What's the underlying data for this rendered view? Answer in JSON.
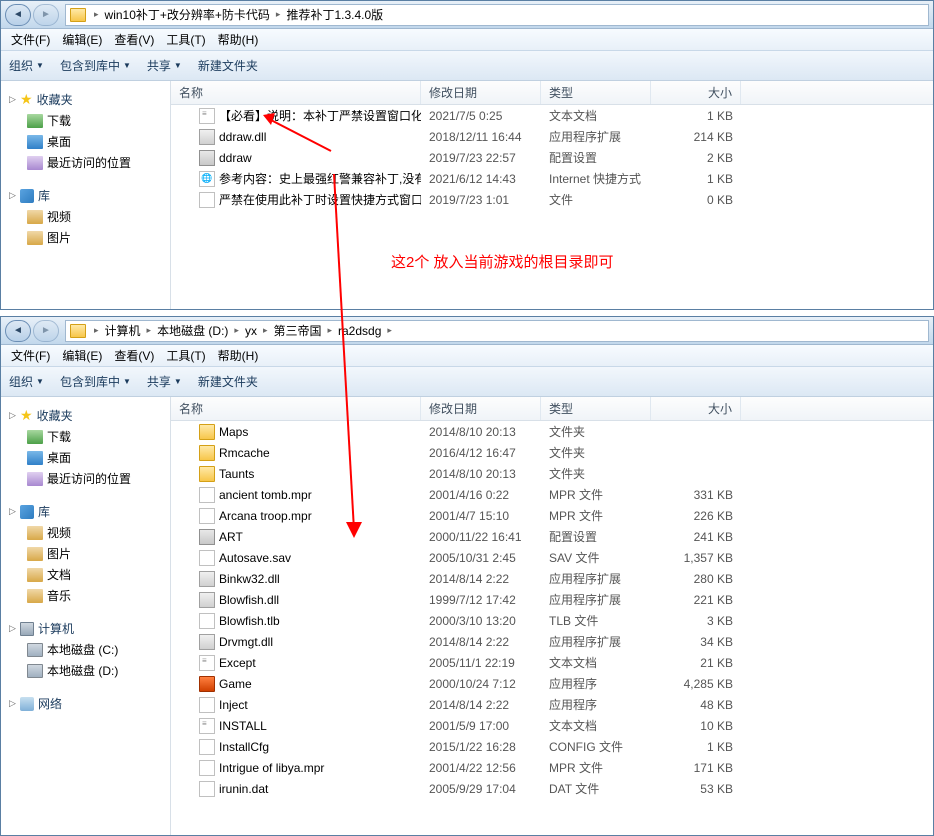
{
  "win1": {
    "breadcrumb": [
      "win10补丁+改分辨率+防卡代码",
      "推荐补丁1.3.4.0版"
    ],
    "menubar": [
      "文件(F)",
      "编辑(E)",
      "查看(V)",
      "工具(T)",
      "帮助(H)"
    ],
    "toolbar": {
      "organize": "组织",
      "include": "包含到库中",
      "share": "共享",
      "newfolder": "新建文件夹"
    },
    "columns": {
      "name": "名称",
      "date": "修改日期",
      "type": "类型",
      "size": "大小"
    },
    "sidebar": {
      "favorites": "收藏夹",
      "fav_items": [
        {
          "label": "下载",
          "icon": "ico-dl"
        },
        {
          "label": "桌面",
          "icon": "ico-desk"
        },
        {
          "label": "最近访问的位置",
          "icon": "ico-recent"
        }
      ],
      "libraries": "库",
      "lib_items": [
        {
          "label": "视频",
          "icon": "ico-lib"
        },
        {
          "label": "图片",
          "icon": "ico-lib"
        }
      ]
    },
    "files": [
      {
        "name": "【必看】说明：本补丁严禁设置窗口化",
        "date": "2021/7/5 0:25",
        "type": "文本文档",
        "size": "1 KB",
        "icon": "fico-txt"
      },
      {
        "name": "ddraw.dll",
        "date": "2018/12/11 16:44",
        "type": "应用程序扩展",
        "size": "214 KB",
        "icon": "fico-dll"
      },
      {
        "name": "ddraw",
        "date": "2019/7/23 22:57",
        "type": "配置设置",
        "size": "2 KB",
        "icon": "fico-cfg"
      },
      {
        "name": "参考内容：史上最强红警兼容补丁,没有...",
        "date": "2021/6/12 14:43",
        "type": "Internet 快捷方式",
        "size": "1 KB",
        "icon": "fico-url"
      },
      {
        "name": "严禁在使用此补丁时设置快捷方式窗口化...",
        "date": "2019/7/23 1:01",
        "type": "文件",
        "size": "0 KB",
        "icon": "fico-generic"
      }
    ]
  },
  "annotation_text": "这2个  放入当前游戏的根目录即可",
  "win2": {
    "breadcrumb": [
      "计算机",
      "本地磁盘 (D:)",
      "yx",
      "第三帝国",
      "ra2dsdg"
    ],
    "menubar": [
      "文件(F)",
      "编辑(E)",
      "查看(V)",
      "工具(T)",
      "帮助(H)"
    ],
    "toolbar": {
      "organize": "组织",
      "include": "包含到库中",
      "share": "共享",
      "newfolder": "新建文件夹"
    },
    "columns": {
      "name": "名称",
      "date": "修改日期",
      "type": "类型",
      "size": "大小"
    },
    "sidebar": {
      "favorites": "收藏夹",
      "fav_items": [
        {
          "label": "下载",
          "icon": "ico-dl"
        },
        {
          "label": "桌面",
          "icon": "ico-desk"
        },
        {
          "label": "最近访问的位置",
          "icon": "ico-recent"
        }
      ],
      "libraries": "库",
      "lib_items": [
        {
          "label": "视频",
          "icon": "ico-lib"
        },
        {
          "label": "图片",
          "icon": "ico-lib"
        },
        {
          "label": "文档",
          "icon": "ico-lib"
        },
        {
          "label": "音乐",
          "icon": "ico-lib"
        }
      ],
      "computer": "计算机",
      "comp_items": [
        {
          "label": "本地磁盘 (C:)",
          "icon": "ico-drive"
        },
        {
          "label": "本地磁盘 (D:)",
          "icon": "ico-drive"
        }
      ],
      "network": "网络"
    },
    "files": [
      {
        "name": "Maps",
        "date": "2014/8/10 20:13",
        "type": "文件夹",
        "size": "",
        "icon": "fico-folder"
      },
      {
        "name": "Rmcache",
        "date": "2016/4/12 16:47",
        "type": "文件夹",
        "size": "",
        "icon": "fico-folder"
      },
      {
        "name": "Taunts",
        "date": "2014/8/10 20:13",
        "type": "文件夹",
        "size": "",
        "icon": "fico-folder"
      },
      {
        "name": "ancient tomb.mpr",
        "date": "2001/4/16 0:22",
        "type": "MPR 文件",
        "size": "331 KB",
        "icon": "fico-generic"
      },
      {
        "name": "Arcana troop.mpr",
        "date": "2001/4/7 15:10",
        "type": "MPR 文件",
        "size": "226 KB",
        "icon": "fico-generic"
      },
      {
        "name": "ART",
        "date": "2000/11/22 16:41",
        "type": "配置设置",
        "size": "241 KB",
        "icon": "fico-cfg"
      },
      {
        "name": "Autosave.sav",
        "date": "2005/10/31 2:45",
        "type": "SAV 文件",
        "size": "1,357 KB",
        "icon": "fico-generic"
      },
      {
        "name": "Binkw32.dll",
        "date": "2014/8/14 2:22",
        "type": "应用程序扩展",
        "size": "280 KB",
        "icon": "fico-dll"
      },
      {
        "name": "Blowfish.dll",
        "date": "1999/7/12 17:42",
        "type": "应用程序扩展",
        "size": "221 KB",
        "icon": "fico-dll"
      },
      {
        "name": "Blowfish.tlb",
        "date": "2000/3/10 13:20",
        "type": "TLB 文件",
        "size": "3 KB",
        "icon": "fico-generic"
      },
      {
        "name": "Drvmgt.dll",
        "date": "2014/8/14 2:22",
        "type": "应用程序扩展",
        "size": "34 KB",
        "icon": "fico-dll"
      },
      {
        "name": "Except",
        "date": "2005/11/1 22:19",
        "type": "文本文档",
        "size": "21 KB",
        "icon": "fico-txt"
      },
      {
        "name": "Game",
        "date": "2000/10/24 7:12",
        "type": "应用程序",
        "size": "4,285 KB",
        "icon": "fico-exe"
      },
      {
        "name": "Inject",
        "date": "2014/8/14 2:22",
        "type": "应用程序",
        "size": "48 KB",
        "icon": "fico-generic"
      },
      {
        "name": "INSTALL",
        "date": "2001/5/9 17:00",
        "type": "文本文档",
        "size": "10 KB",
        "icon": "fico-txt"
      },
      {
        "name": "InstallCfg",
        "date": "2015/1/22 16:28",
        "type": "CONFIG 文件",
        "size": "1 KB",
        "icon": "fico-generic"
      },
      {
        "name": "Intrigue of libya.mpr",
        "date": "2001/4/22 12:56",
        "type": "MPR 文件",
        "size": "171 KB",
        "icon": "fico-generic"
      },
      {
        "name": "irunin.dat",
        "date": "2005/9/29 17:04",
        "type": "DAT 文件",
        "size": "53 KB",
        "icon": "fico-generic"
      }
    ]
  }
}
